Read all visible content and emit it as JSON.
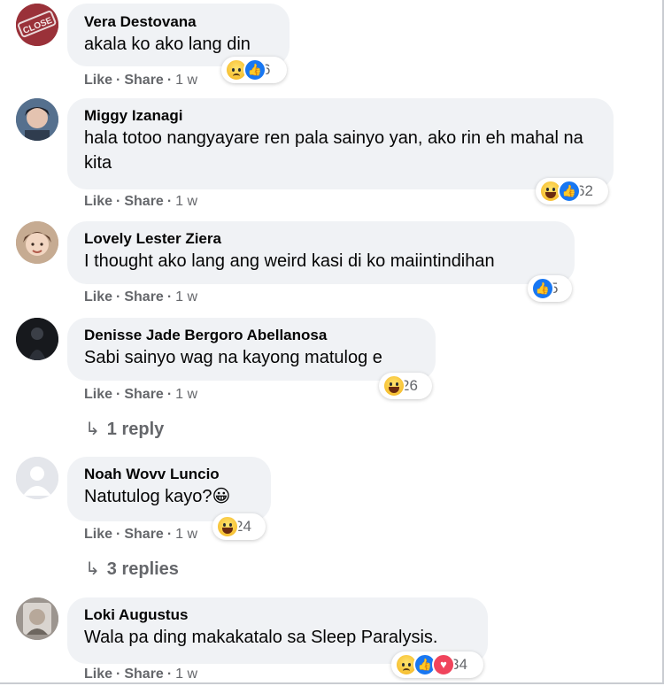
{
  "comments": [
    {
      "author": "Vera Destovana",
      "text": "akala ko ako lang din",
      "actions": {
        "like": "Like",
        "share": "Share",
        "time": "1 w"
      },
      "reactions": {
        "icons": [
          "sad-icon",
          "like-icon"
        ],
        "count": "6"
      },
      "avatar_label": "CLOSE"
    },
    {
      "author": "Miggy Izanagi",
      "text": "hala totoo nangyayare ren pala sainyo yan, ako rin eh mahal na kita",
      "actions": {
        "like": "Like",
        "share": "Share",
        "time": "1 w"
      },
      "reactions": {
        "icons": [
          "haha-icon",
          "like-icon"
        ],
        "count": "62"
      }
    },
    {
      "author": "Lovely Lester Ziera",
      "text": "I thought ako lang ang weird kasi di ko maiintindihan",
      "actions": {
        "like": "Like",
        "share": "Share",
        "time": "1 w"
      },
      "reactions": {
        "icons": [
          "like-icon"
        ],
        "count": "5"
      }
    },
    {
      "author": "Denisse Jade Bergoro Abellanosa",
      "text": "Sabi sainyo wag na kayong matulog e",
      "actions": {
        "like": "Like",
        "share": "Share",
        "time": "1 w"
      },
      "reactions": {
        "icons": [
          "haha-icon"
        ],
        "count": "26"
      },
      "replies": "1 reply"
    },
    {
      "author": "Noah Wovv Luncio",
      "text": "Natutulog kayo?",
      "text_emoji": "😀",
      "actions": {
        "like": "Like",
        "share": "Share",
        "time": "1 w"
      },
      "reactions": {
        "icons": [
          "haha-icon"
        ],
        "count": "24"
      },
      "replies": "3 replies"
    },
    {
      "author": "Loki Augustus",
      "text": "Wala pa ding makakatalo sa Sleep Paralysis.",
      "actions": {
        "like": "Like",
        "share": "Share",
        "time": "1 w"
      },
      "reactions": {
        "icons": [
          "sad-icon",
          "like-icon",
          "care-icon"
        ],
        "count": "34"
      }
    }
  ],
  "ui": {
    "dot": "·",
    "reply_arrow": "↳"
  }
}
